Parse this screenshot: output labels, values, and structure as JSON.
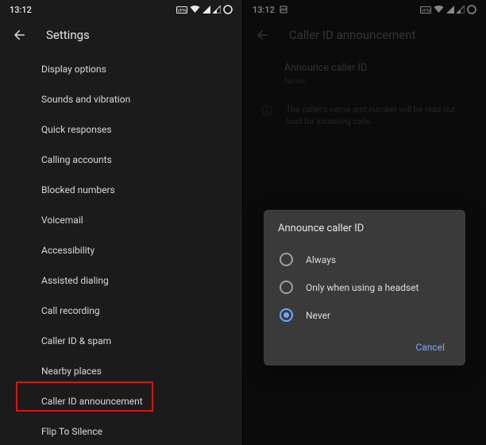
{
  "status": {
    "time": "13:12"
  },
  "left": {
    "header_title": "Settings",
    "items": [
      "Display options",
      "Sounds and vibration",
      "Quick responses",
      "Calling accounts",
      "Blocked numbers",
      "Voicemail",
      "Accessibility",
      "Assisted dialing",
      "Call recording",
      "Caller ID & spam",
      "Nearby places",
      "Caller ID announcement",
      "Flip To Silence"
    ]
  },
  "right": {
    "header_title": "Caller ID announcement",
    "section_title": "Announce caller ID",
    "section_value": "Never",
    "info_text": "The caller's name and number will be read out loud for incoming calls."
  },
  "dialog": {
    "title": "Announce caller ID",
    "options": [
      "Always",
      "Only when using a headset",
      "Never"
    ],
    "selected_index": 2,
    "cancel": "Cancel"
  }
}
